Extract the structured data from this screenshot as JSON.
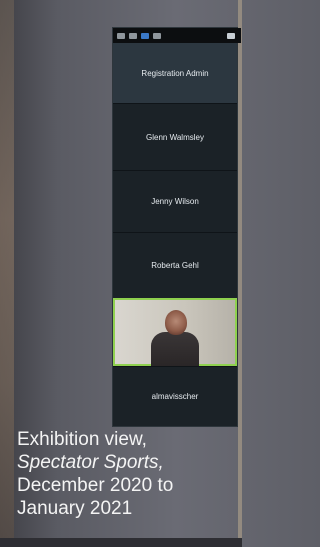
{
  "zoom": {
    "participants": [
      {
        "name": "Registration Admin"
      },
      {
        "name": "Glenn Walmsley"
      },
      {
        "name": "Jenny Wilson"
      },
      {
        "name": "Roberta Gehl"
      },
      {
        "name": ""
      },
      {
        "name": "almavisscher"
      }
    ]
  },
  "caption": {
    "line1": "Exhibition view,",
    "line2": "Spectator Sports,",
    "line3": "December 2020 to",
    "line4": "January 2021"
  },
  "colors": {
    "active_speaker_border": "#8fd14f",
    "panel_bg": "#1b2227"
  }
}
